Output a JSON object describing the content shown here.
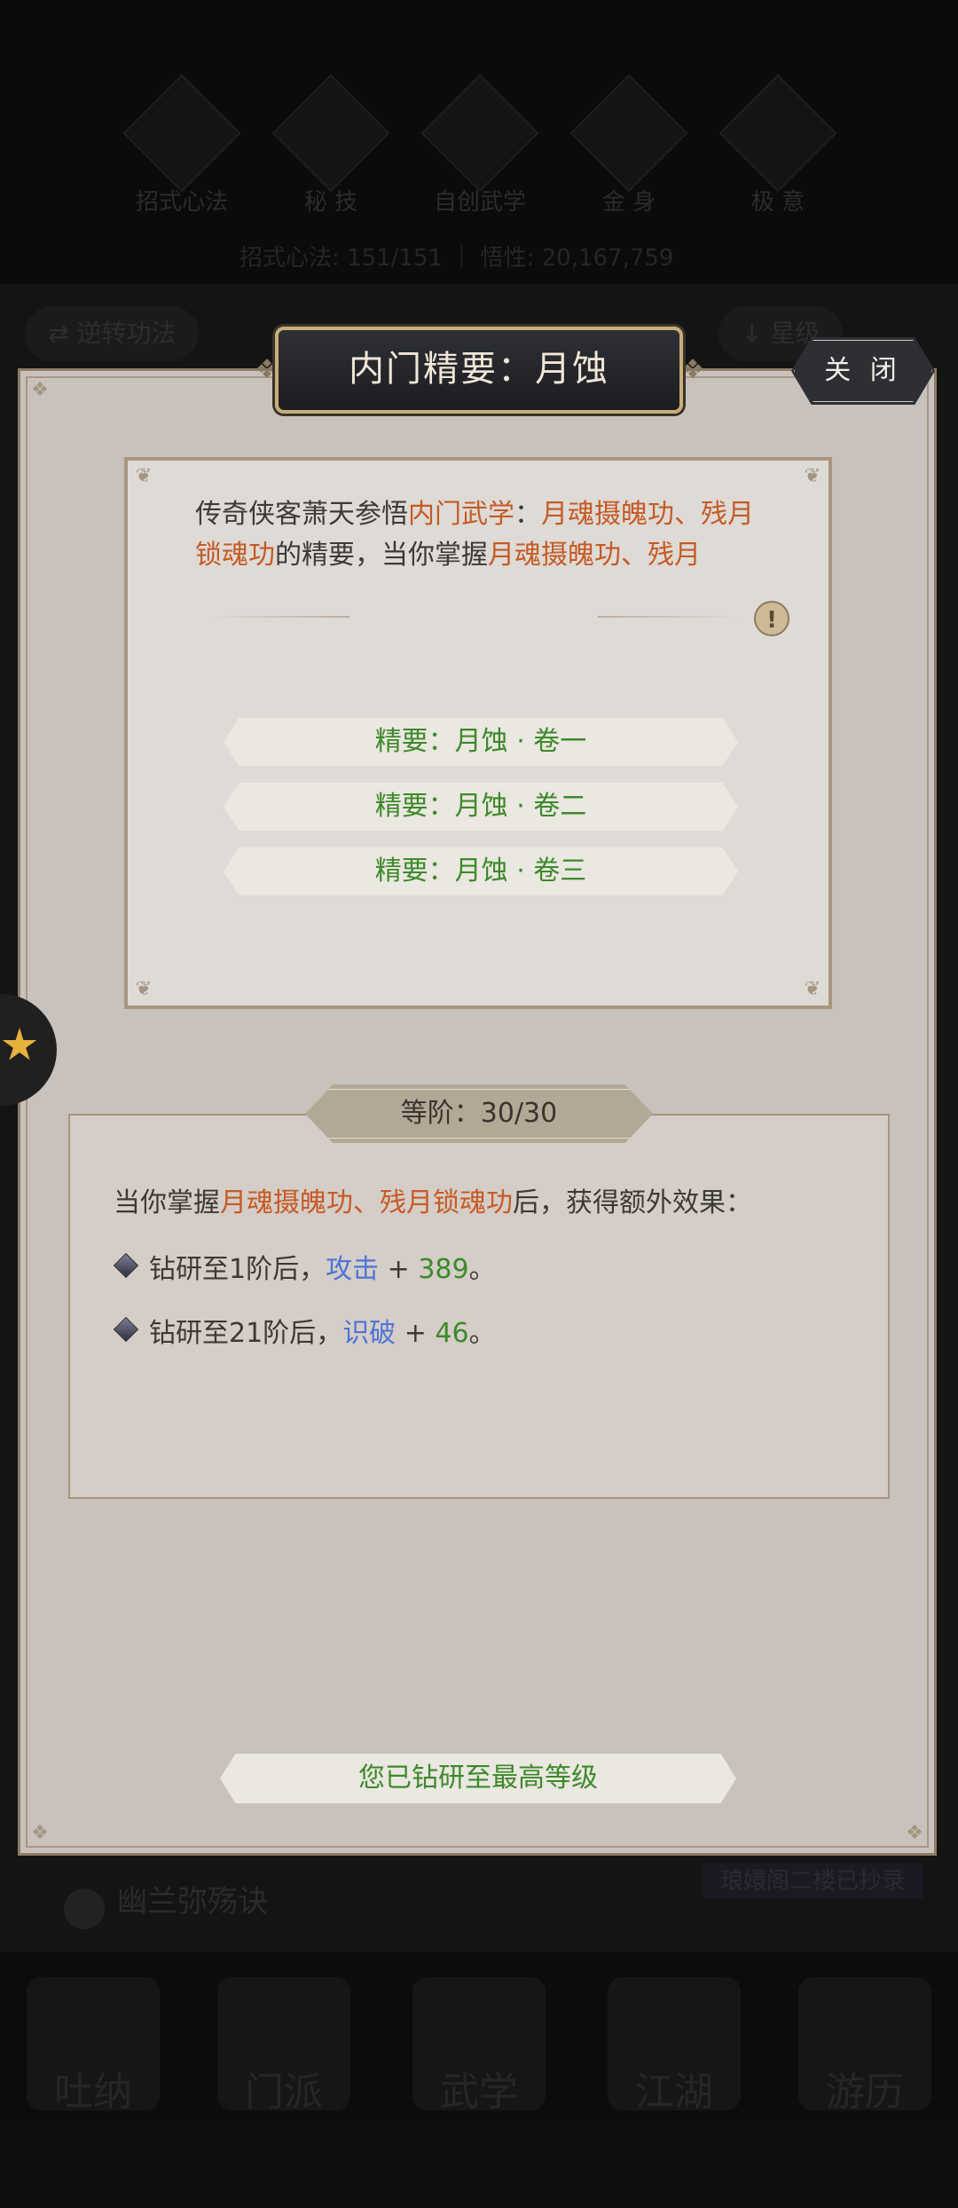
{
  "background": {
    "tabs": [
      "招式心法",
      "秘 技",
      "自创武学",
      "金 身",
      "极 意"
    ],
    "stat_text": "招式心法: 151/151  ｜ 悟性: 20,167,759",
    "left_pill": "⇄ 逆转功法",
    "right_pill": "↓ 星级",
    "row_label": "幽兰弥殇诀",
    "banner": "琅嬛阁二楼已抄录",
    "nav": [
      "吐纳",
      "门派",
      "武学",
      "江湖",
      "游历"
    ]
  },
  "modal": {
    "title": "内门精要：月蚀",
    "close_label": "关 闭",
    "desc": {
      "p1": "传奇侠客萧天参悟",
      "p2": "内门武学",
      "p3": "：",
      "p4": "月魂摄魄功、残月锁魂功",
      "p5": "的精要，当你掌握",
      "p6": "月魂摄魄功、残月"
    },
    "info_icon": "!",
    "volumes": [
      "精要：月蚀 · 卷一",
      "精要：月蚀 · 卷二",
      "精要：月蚀 · 卷三"
    ],
    "rank": {
      "label": "等阶：30/30",
      "intro_prefix": "当你掌握",
      "intro_skills": "月魂摄魄功、残月锁魂功",
      "intro_suffix": "后，获得额外效果：",
      "effects": [
        {
          "prefix": "钻研至1阶后，",
          "stat": "攻击",
          "plus": " + ",
          "value": "389",
          "end": "。"
        },
        {
          "prefix": "钻研至21阶后，",
          "stat": "识破",
          "plus": " + ",
          "value": "46",
          "end": "。"
        }
      ]
    },
    "max_status": "您已钻研至最高等级"
  },
  "colors": {
    "panel": "#c9c1bc",
    "card": "#dedad6",
    "highlight_orange": "#c65a24",
    "highlight_green": "#3c8a2a",
    "highlight_blue": "#4d74d6",
    "title_plate": "#1c1d22"
  }
}
